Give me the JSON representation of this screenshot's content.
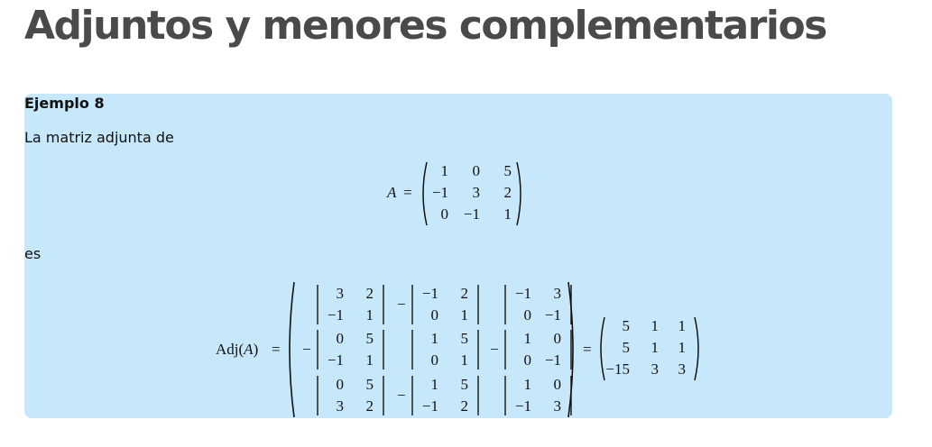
{
  "page": {
    "title": "Adjuntos y menores complementarios"
  },
  "example": {
    "heading": "Ejemplo 8",
    "intro": "La matriz adjunta de",
    "connector": "es",
    "matrix_A": {
      "name": "A",
      "equals": "=",
      "rows": [
        [
          "1",
          "0",
          "5"
        ],
        [
          "−1",
          "3",
          "2"
        ],
        [
          "0",
          "−1",
          "1"
        ]
      ]
    },
    "adjugate": {
      "lhs": "Adj(A)",
      "lhs_fn": "Adj(",
      "lhs_var": "A",
      "lhs_close": ")",
      "equals": "=",
      "cofactors": [
        [
          {
            "sign": "",
            "rows": [
              [
                "3",
                "2"
              ],
              [
                "−1",
                "1"
              ]
            ]
          },
          {
            "sign": "−",
            "rows": [
              [
                "−1",
                "2"
              ],
              [
                "0",
                "1"
              ]
            ]
          },
          {
            "sign": "",
            "rows": [
              [
                "−1",
                "3"
              ],
              [
                "0",
                "−1"
              ]
            ]
          }
        ],
        [
          {
            "sign": "−",
            "rows": [
              [
                "0",
                "5"
              ],
              [
                "−1",
                "1"
              ]
            ]
          },
          {
            "sign": "",
            "rows": [
              [
                "1",
                "5"
              ],
              [
                "0",
                "1"
              ]
            ]
          },
          {
            "sign": "−",
            "rows": [
              [
                "1",
                "0"
              ],
              [
                "0",
                "−1"
              ]
            ]
          }
        ],
        [
          {
            "sign": "",
            "rows": [
              [
                "0",
                "5"
              ],
              [
                "3",
                "2"
              ]
            ]
          },
          {
            "sign": "−",
            "rows": [
              [
                "1",
                "5"
              ],
              [
                "−1",
                "2"
              ]
            ]
          },
          {
            "sign": "",
            "rows": [
              [
                "1",
                "0"
              ],
              [
                "−1",
                "3"
              ]
            ]
          }
        ]
      ],
      "result_rows": [
        [
          "5",
          "1",
          "1"
        ],
        [
          "5",
          "1",
          "1"
        ],
        [
          "−15",
          "3",
          "3"
        ]
      ]
    }
  }
}
